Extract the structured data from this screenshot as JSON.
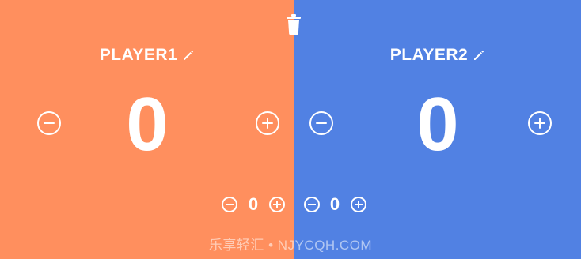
{
  "players": [
    {
      "name": "PLAYER1",
      "score": "0",
      "sub_score": "0",
      "color": "#ff8f5e"
    },
    {
      "name": "PLAYER2",
      "score": "0",
      "sub_score": "0",
      "color": "#5181e3"
    }
  ],
  "icons": {
    "trash": "trash-icon",
    "edit": "pencil-icon",
    "minus": "minus-circle-icon",
    "plus": "plus-circle-icon"
  },
  "watermark": "乐享轻汇 • NJYCQH.COM"
}
